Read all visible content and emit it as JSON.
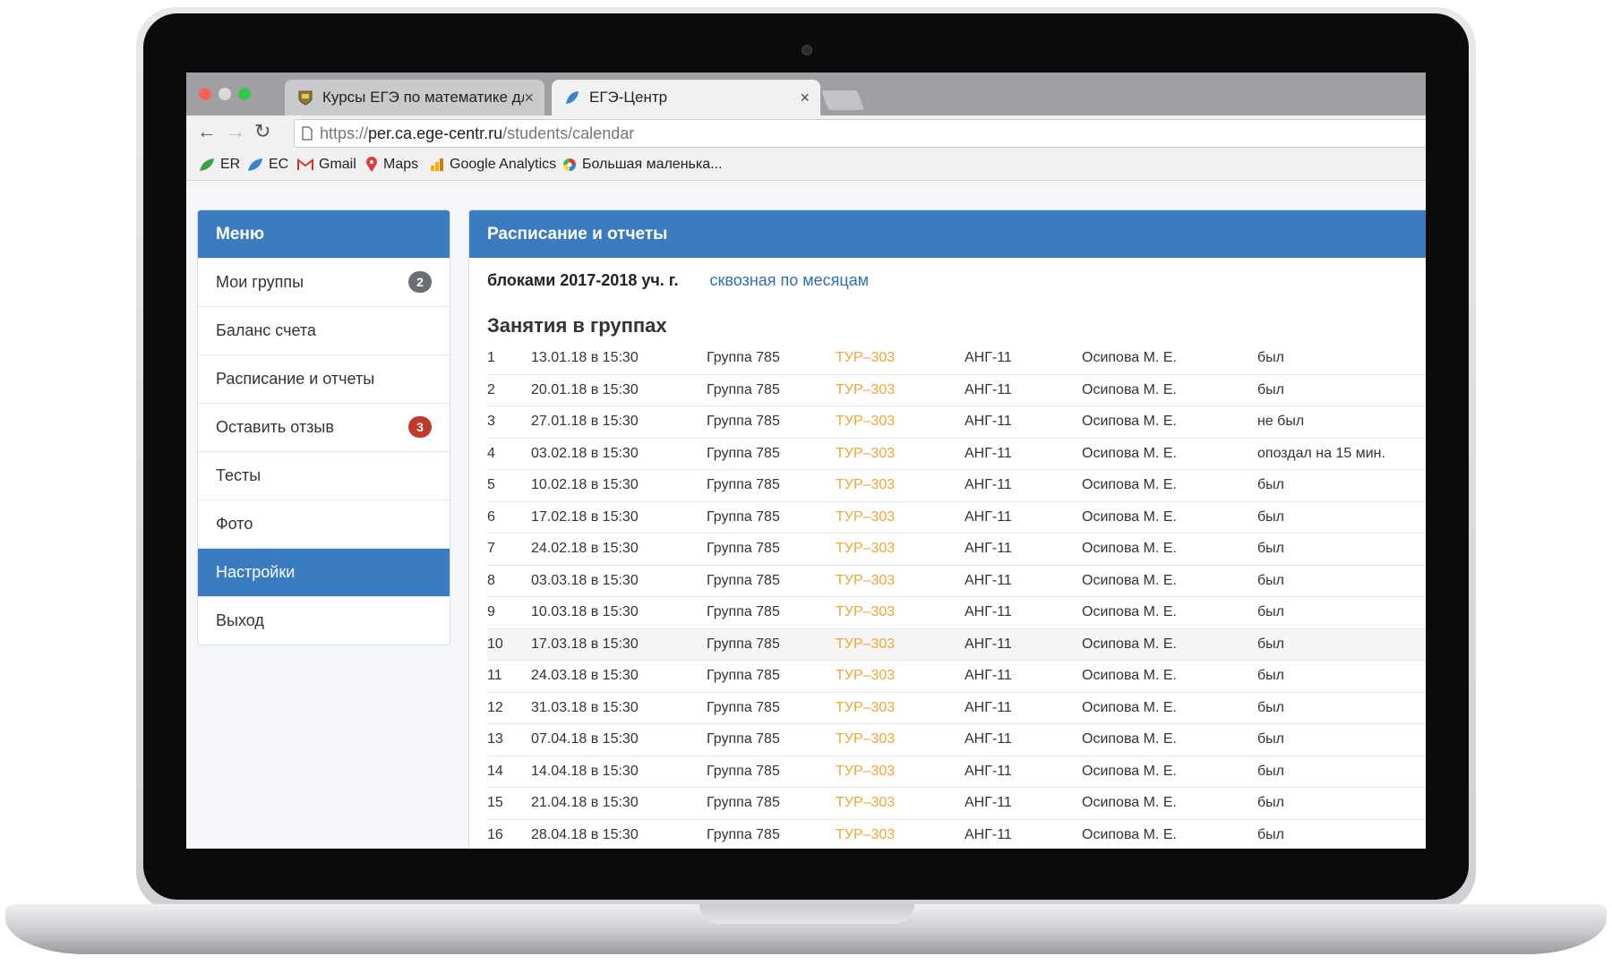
{
  "browser": {
    "tabs": [
      {
        "title": "Курсы ЕГЭ по математике для",
        "close": "×"
      },
      {
        "title": "ЕГЭ-Центр",
        "close": "×"
      }
    ],
    "url_scheme": "https://",
    "url_host": "per.ca.ege-centr.ru",
    "url_path": "/students/calendar",
    "nav": {
      "back": "←",
      "forward": "→",
      "reload": "↻"
    },
    "bookmarks": [
      {
        "label": "ER",
        "icon": "leaf-green-icon"
      },
      {
        "label": "EC",
        "icon": "leaf-blue-icon"
      },
      {
        "label": "Gmail",
        "icon": "gmail-icon"
      },
      {
        "label": "Maps",
        "icon": "map-pin-icon"
      },
      {
        "label": "Google Analytics",
        "icon": "analytics-icon"
      },
      {
        "label": "Большая маленька...",
        "icon": "color-wheel-icon"
      }
    ]
  },
  "sidebar": {
    "title": "Меню",
    "items": [
      {
        "label": "Мои группы",
        "badge": "2"
      },
      {
        "label": "Баланс счета"
      },
      {
        "label": "Расписание и отчеты"
      },
      {
        "label": "Оставить отзыв",
        "badge": "3"
      },
      {
        "label": "Тесты"
      },
      {
        "label": "Фото"
      },
      {
        "label": "Настройки",
        "active": true
      },
      {
        "label": "Выход"
      }
    ]
  },
  "main": {
    "title": "Расписание и отчеты",
    "view_current": "блоками 2017-2018 уч. г.",
    "view_link": "сквозная по месяцам",
    "section_title": "Занятия в группах",
    "rows": [
      [
        "1",
        "13.01.18 в 15:30",
        "Группа 785",
        "ТУР–303",
        "АНГ-11",
        "Осипова М. Е.",
        "был"
      ],
      [
        "2",
        "20.01.18 в 15:30",
        "Группа 785",
        "ТУР–303",
        "АНГ-11",
        "Осипова М. Е.",
        "был"
      ],
      [
        "3",
        "27.01.18 в 15:30",
        "Группа 785",
        "ТУР–303",
        "АНГ-11",
        "Осипова М. Е.",
        "не был"
      ],
      [
        "4",
        "03.02.18 в 15:30",
        "Группа 785",
        "ТУР–303",
        "АНГ-11",
        "Осипова М. Е.",
        "опоздал на 15 мин."
      ],
      [
        "5",
        "10.02.18 в 15:30",
        "Группа 785",
        "ТУР–303",
        "АНГ-11",
        "Осипова М. Е.",
        "был"
      ],
      [
        "6",
        "17.02.18 в 15:30",
        "Группа 785",
        "ТУР–303",
        "АНГ-11",
        "Осипова М. Е.",
        "был"
      ],
      [
        "7",
        "24.02.18 в 15:30",
        "Группа 785",
        "ТУР–303",
        "АНГ-11",
        "Осипова М. Е.",
        "был"
      ],
      [
        "8",
        "03.03.18 в 15:30",
        "Группа 785",
        "ТУР–303",
        "АНГ-11",
        "Осипова М. Е.",
        "был"
      ],
      [
        "9",
        "10.03.18 в 15:30",
        "Группа 785",
        "ТУР–303",
        "АНГ-11",
        "Осипова М. Е.",
        "был"
      ],
      [
        "10",
        "17.03.18 в 15:30",
        "Группа 785",
        "ТУР–303",
        "АНГ-11",
        "Осипова М. Е.",
        "был"
      ],
      [
        "11",
        "24.03.18 в 15:30",
        "Группа 785",
        "ТУР–303",
        "АНГ-11",
        "Осипова М. Е.",
        "был"
      ],
      [
        "12",
        "31.03.18 в 15:30",
        "Группа 785",
        "ТУР–303",
        "АНГ-11",
        "Осипова М. Е.",
        "был"
      ],
      [
        "13",
        "07.04.18 в 15:30",
        "Группа 785",
        "ТУР–303",
        "АНГ-11",
        "Осипова М. Е.",
        "был"
      ],
      [
        "14",
        "14.04.18 в 15:30",
        "Группа 785",
        "ТУР–303",
        "АНГ-11",
        "Осипова М. Е.",
        "был"
      ],
      [
        "15",
        "21.04.18 в 15:30",
        "Группа 785",
        "ТУР–303",
        "АНГ-11",
        "Осипова М. Е.",
        "был"
      ],
      [
        "16",
        "28.04.18 в 15:30",
        "Группа 785",
        "ТУР–303",
        "АНГ-11",
        "Осипова М. Е.",
        "был"
      ]
    ],
    "highlight_row": 9
  },
  "colors": {
    "accent": "#3b7bbf",
    "room": "#f0a534",
    "badge_gray": "#6b6e72",
    "badge_red": "#c0392b"
  }
}
